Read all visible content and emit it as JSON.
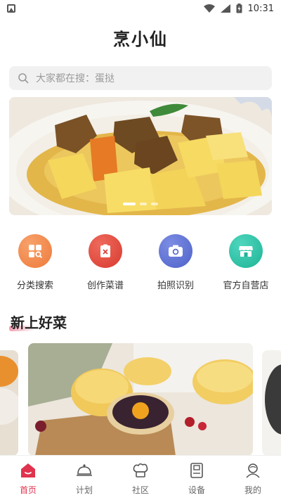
{
  "status_bar": {
    "time": "10:31"
  },
  "app": {
    "title": "烹小仙"
  },
  "search": {
    "placeholder": "大家都在搜：蛋挞"
  },
  "banner": {
    "dots": 3,
    "active_dot": 0
  },
  "quick_menu": [
    {
      "label": "分类搜索",
      "icon": "category-icon",
      "color": "#f28b4c"
    },
    {
      "label": "创作菜谱",
      "icon": "recipe-create-icon",
      "color": "#e5483a"
    },
    {
      "label": "拍照识别",
      "icon": "camera-icon",
      "color": "#5b6fd6"
    },
    {
      "label": "官方自营店",
      "icon": "store-icon",
      "color": "#2bc4a6"
    }
  ],
  "section": {
    "title": "新上好菜"
  },
  "tabs": [
    {
      "label": "首页",
      "icon": "home-icon",
      "active": true
    },
    {
      "label": "计划",
      "icon": "cloche-icon",
      "active": false
    },
    {
      "label": "社区",
      "icon": "chef-hat-icon",
      "active": false
    },
    {
      "label": "设备",
      "icon": "device-icon",
      "active": false
    },
    {
      "label": "我的",
      "icon": "profile-icon",
      "active": false
    }
  ],
  "colors": {
    "accent": "#e0344e"
  }
}
